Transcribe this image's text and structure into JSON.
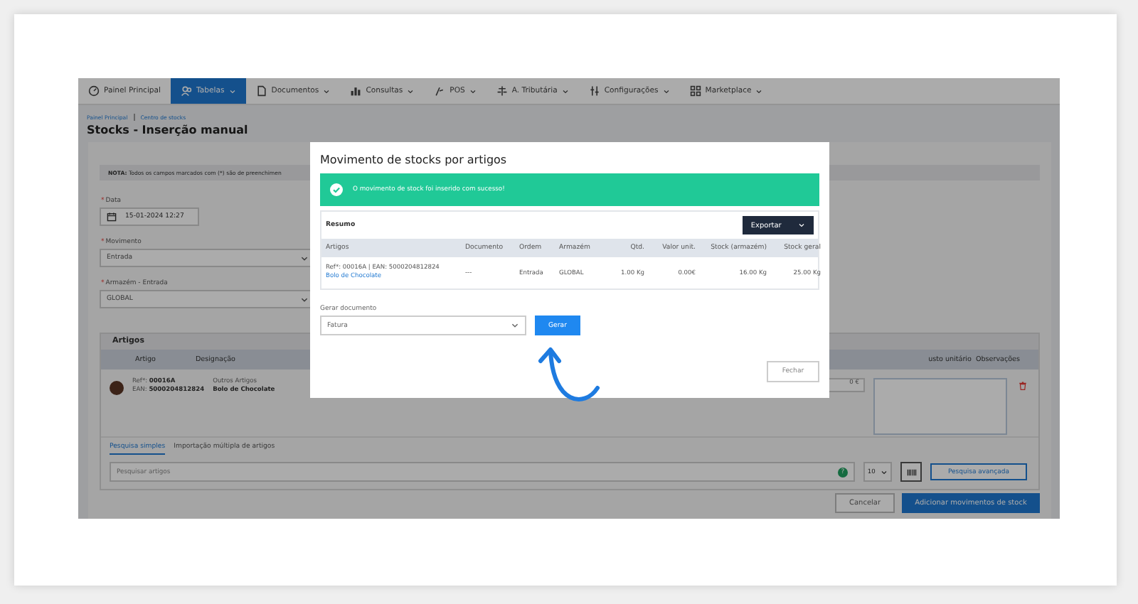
{
  "nav": [
    {
      "label": "Painel Principal",
      "selected": false,
      "caret": false
    },
    {
      "label": "Tabelas",
      "selected": true,
      "caret": true
    },
    {
      "label": "Documentos",
      "selected": false,
      "caret": true
    },
    {
      "label": "Consultas",
      "selected": false,
      "caret": true
    },
    {
      "label": "POS",
      "selected": false,
      "caret": true
    },
    {
      "label": "A. Tributária",
      "selected": false,
      "caret": true
    },
    {
      "label": "Configurações",
      "selected": false,
      "caret": true
    },
    {
      "label": "Marketplace",
      "selected": false,
      "caret": true
    }
  ],
  "breadcrumb": [
    "Painel Principal",
    "Centro de stocks"
  ],
  "page_title": "Stocks - Inserção manual",
  "note": "**NOTA:** Todos os campos marcados com (*) são de preenchimen",
  "fields": [
    {
      "kind": "date",
      "mark": "*",
      "label": "Data",
      "value": "15-01-2024 12:27"
    },
    {
      "kind": "select",
      "mark": "*",
      "label": "Movimento",
      "value": "Entrada"
    },
    {
      "kind": "select",
      "mark": "*",
      "label": "Armazém - Entrada",
      "value": "GLOBAL"
    }
  ],
  "articles": {
    "title": "Artigos",
    "columns_left": [
      "Artigo",
      "Designação"
    ],
    "columns_right": [
      "usto unitário",
      "Observações"
    ],
    "row": {
      "ref": "Ref*: **00016A**",
      "ean": "EAN: **5000204812824**",
      "family": "Outros Artigos",
      "name": "Bolo de Chocolate",
      "cost": "0 €"
    },
    "tabs": [
      {
        "label": "Pesquisa simples",
        "selected": true
      },
      {
        "label": "Importação múltipla de artigos",
        "selected": false
      }
    ],
    "search": {
      "placeholder": "Pesquisar artigos"
    },
    "help": "?",
    "page_size": "10",
    "advanced_button": "Pesquisa avançada"
  },
  "footer_buttons": [
    {
      "kind": "secondary",
      "label": "Cancelar"
    },
    {
      "kind": "primary",
      "label": "Adicionar movimentos de stock"
    }
  ],
  "modal": {
    "title": "Movimento de stocks por artigos",
    "alert": "O movimento de stock foi inserido com sucesso!",
    "summary_title": "Resumo",
    "export_button": "Exportar",
    "columns": [
      "Artigos",
      "Documento",
      "Ordem",
      "Armazém",
      "Qtd.",
      "Valor unit.",
      "Stock (armazém)",
      "Stock geral"
    ],
    "rows": [
      {
        "cells": [
          "Ref*: 00016A | EAN: 5000204812824",
          "---",
          "Entrada",
          "GLOBAL",
          "1.00 Kg",
          "0.00€",
          "16.00 Kg",
          "25.00 Kg"
        ],
        "link": "Bolo de Chocolate"
      }
    ],
    "document_label": "Gerar documento",
    "document_value": "Fatura",
    "generate_button": "Gerar",
    "close_button": "Fechar"
  }
}
